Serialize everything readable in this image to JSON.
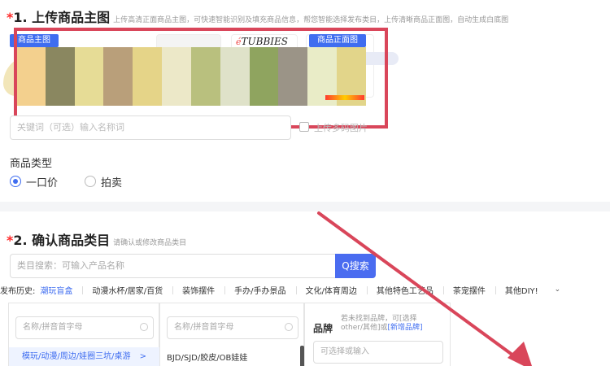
{
  "section1": {
    "required_mark": "*",
    "title": "1. 上传商品主图",
    "desc": "上传高清正面商品主图，可快速智能识别及填充商品信息，帮您智能选择发布类目，上传清晰商品正面图，自动生成白底图",
    "tag_main": "商品主图",
    "tag_front": "商品正面图",
    "brand_art_a": "é",
    "brand_art_b": "TUBBIES",
    "mosaic_colors": [
      "#f3d08e",
      "#8a8760",
      "#e6dc96",
      "#b99f7a",
      "#e5d488",
      "#ece8c8",
      "#b9c07e",
      "#dfe2c9",
      "#8fa45f",
      "#9b9487",
      "#e9ecc7",
      "#e2d58a"
    ],
    "keyword_placeholder": "关键词（可选）输入名称词",
    "checkbox_label": "上传多码图片"
  },
  "product_type": {
    "label": "商品类型",
    "options": [
      "一口价",
      "拍卖"
    ],
    "selected": "一口价"
  },
  "section2": {
    "required_mark": "*",
    "title": "2. 确认商品类目",
    "desc": "请确认或修改商品类目",
    "search_placeholder": "类目搜索：可输入产品名称",
    "search_button": "Q搜索",
    "history_label": "发布历史:",
    "history_items": [
      "潮玩盲盒",
      "动漫水杯/居家/百货",
      "装饰摆件",
      "手办/手办景品",
      "文化/体育周边",
      "其他特色工艺品",
      "茶宠摆件",
      "其他DIY!"
    ],
    "col1_placeholder": "名称/拼音首字母",
    "col1_selected": "模玩/动漫/周边/娃圈三坑/桌游",
    "col1_arrow": ">",
    "col2_placeholder": "名称/拼音首字母",
    "col2_item": "BJD/SJD/胶皮/OB娃娃",
    "brand_label": "品牌",
    "brand_hint": "若未找到品牌，可[选择other/其他]或",
    "brand_link": "[新增品牌]",
    "brand_placeholder": "可选择或输入"
  },
  "colors": {
    "accent": "#3f6df0",
    "highlight_box": "#d9465a",
    "required": "#ff2a2a"
  }
}
